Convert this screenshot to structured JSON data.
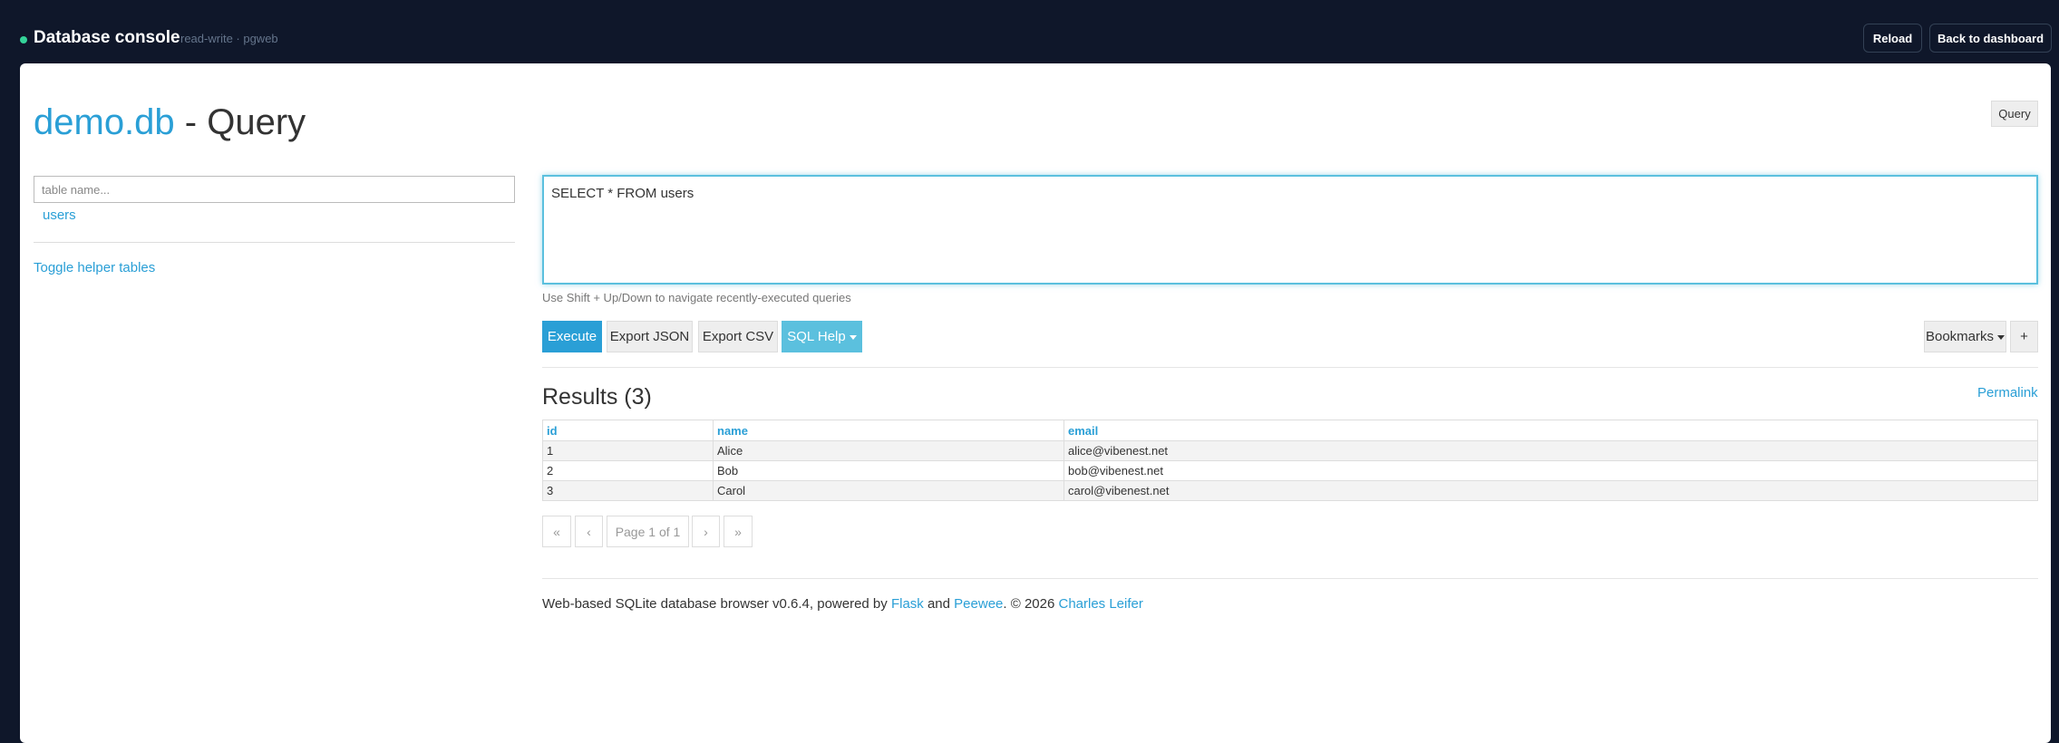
{
  "header": {
    "title": "Database console",
    "subtitle": "read-write · pgweb",
    "reload_label": "Reload",
    "back_label": "Back to dashboard",
    "status_color": "#34d399"
  },
  "page": {
    "db_name": "demo.db",
    "title_suffix": " - Query",
    "mode_tag": "Query"
  },
  "sidebar": {
    "filter_placeholder": "table name...",
    "tables": [
      "users"
    ],
    "toggle_helper_label": "Toggle helper tables"
  },
  "query": {
    "sql": "SELECT * FROM users",
    "hint": "Use Shift + Up/Down to navigate recently-executed queries",
    "execute_label": "Execute",
    "export_json_label": "Export JSON",
    "export_csv_label": "Export CSV",
    "sql_help_label": "SQL Help",
    "bookmarks_label": "Bookmarks",
    "add_bookmark_label": "+"
  },
  "results": {
    "title": "Results (3)",
    "permalink_label": "Permalink",
    "columns": [
      "id",
      "name",
      "email"
    ],
    "rows": [
      [
        "1",
        "Alice",
        "alice@vibenest.net"
      ],
      [
        "2",
        "Bob",
        "bob@vibenest.net"
      ],
      [
        "3",
        "Carol",
        "carol@vibenest.net"
      ]
    ]
  },
  "pagination": {
    "first": "«",
    "prev": "‹",
    "info": "Page 1 of 1",
    "next": "›",
    "last": "»"
  },
  "footer": {
    "text_before": "Web-based SQLite database browser v0.6.4, powered by ",
    "flask": "Flask",
    "and": " and ",
    "peewee": "Peewee",
    "copyright": ". © 2026 ",
    "author": "Charles Leifer"
  },
  "colors": {
    "accent": "#2a9fd6",
    "info": "#5bc0de",
    "topbar_bg": "#0f172a"
  }
}
